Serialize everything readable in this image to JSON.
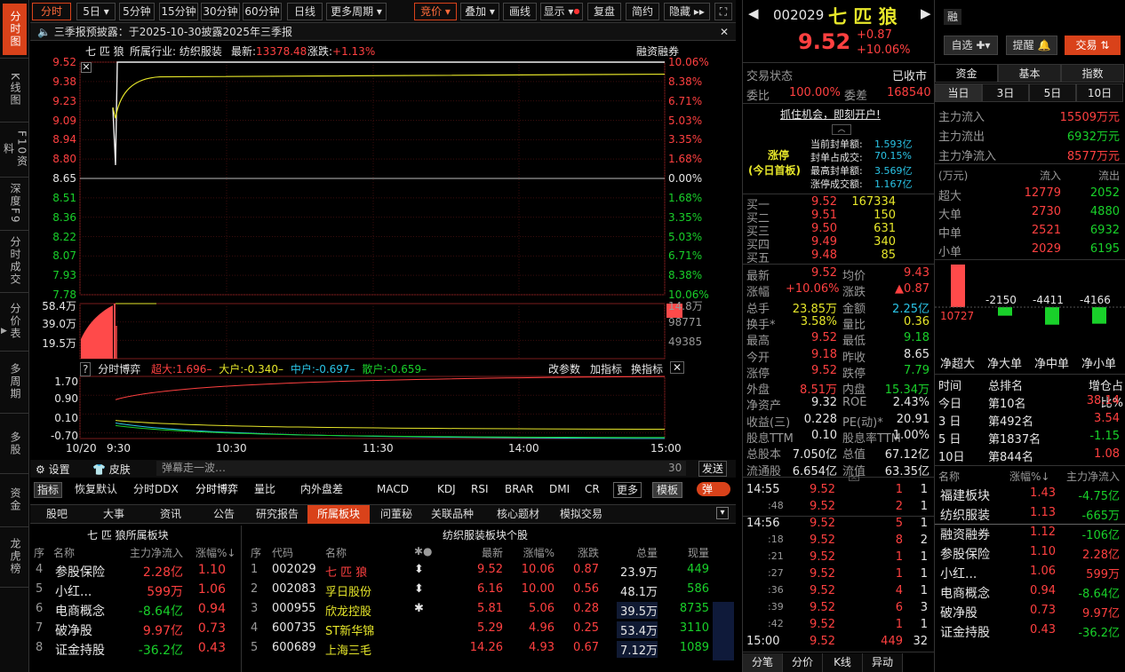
{
  "left_nav": [
    {
      "label": "分时图",
      "active": true
    },
    {
      "label": "K线图"
    },
    {
      "label": "F10资料"
    },
    {
      "label": "深度F9"
    },
    {
      "label": "分时成交"
    },
    {
      "label": "分价表"
    },
    {
      "label": "多周期"
    },
    {
      "label": "多股"
    },
    {
      "label": "资金"
    },
    {
      "label": "龙虎榜"
    }
  ],
  "toolbar": {
    "items": [
      "分时",
      "5日",
      "5分钟",
      "15分钟",
      "30分钟",
      "60分钟",
      "日线",
      "更多周期",
      "竞价",
      "叠加",
      "画线",
      "显示",
      "复盘",
      "简约",
      "隐藏"
    ]
  },
  "notice": {
    "text": "三季报预披露：于2025-10-30披露2025年三季报"
  },
  "chart_header": {
    "name": "七 匹 狼",
    "industry": "所属行业: 纺织服装",
    "latest_label": "最新:",
    "latest": "13378.48",
    "change_label": "涨跌:",
    "change": "+1.13%",
    "margin": "融资融券"
  },
  "chart_data": {
    "type": "line",
    "price_axis": [
      "9.52",
      "9.38",
      "9.23",
      "9.09",
      "8.94",
      "8.80",
      "8.65",
      "8.51",
      "8.36",
      "8.22",
      "8.07",
      "7.93",
      "7.78"
    ],
    "pct_axis": [
      "10.06%",
      "8.38%",
      "6.71%",
      "5.03%",
      "3.35%",
      "1.68%",
      "0.00%",
      "1.68%",
      "3.35%",
      "5.03%",
      "6.71%",
      "8.38%",
      "10.06%"
    ],
    "vol_axis_left": [
      "58.4万",
      "39.0万",
      "19.5万"
    ],
    "vol_axis_right": [
      "14.8万",
      "98771",
      "49385"
    ],
    "x_ticks": [
      "10/20",
      "9:30",
      "10:30",
      "11:30",
      "14:00",
      "15:00"
    ],
    "prev_close": 8.65,
    "open": 9.18,
    "close": 9.52,
    "low": 9.18,
    "flow_axis": [
      "1.70",
      "0.90",
      "0.10",
      "-0.70"
    ]
  },
  "flow_panel": {
    "title": "分时博弈",
    "super": "超大:1.696",
    "big": "大户:-0.340",
    "mid": "中户:-0.697",
    "retail": "散户:-0.659",
    "b1": "改参数",
    "b2": "加指标",
    "b3": "换指标"
  },
  "settings": {
    "settings": "设置",
    "skin": "皮肤",
    "danmu": "弹幕走一波…",
    "count": "30",
    "send": "发送"
  },
  "indicators": [
    "指标",
    "恢复默认",
    "分时DDX",
    "分时博弈",
    "量比",
    "内外盘差",
    "MACD",
    "KDJ",
    "RSI",
    "BRAR",
    "DMI",
    "CR",
    "更多",
    "模板",
    "弹"
  ],
  "info_tabs": [
    "股吧",
    "大事",
    "资讯",
    "公告",
    "研究报告",
    "所属板块",
    "问董秘",
    "关联品种",
    "核心题材",
    "模拟交易"
  ],
  "sector_table": {
    "title": "七 匹 狼所属板块",
    "headers": [
      "序",
      "名称",
      "主力净流入",
      "涨幅%"
    ],
    "rows": [
      [
        "4",
        "参股保险",
        "2.28亿",
        "1.10"
      ],
      [
        "5",
        "小红...",
        "599万",
        "1.06"
      ],
      [
        "6",
        "电商概念",
        "-8.64亿",
        "0.94"
      ],
      [
        "7",
        "破净股",
        "9.97亿",
        "0.73"
      ],
      [
        "8",
        "证金持股",
        "-36.2亿",
        "0.43"
      ]
    ]
  },
  "stock_table": {
    "title": "纺织服装板块个股",
    "headers": [
      "序",
      "代码",
      "名称",
      "",
      "最新",
      "涨幅%",
      "涨跌",
      "总量",
      "现量"
    ],
    "rows": [
      [
        "1",
        "002029",
        "七 匹 狼",
        "⬍",
        "9.52",
        "10.06",
        "0.87",
        "23.9万",
        "449"
      ],
      [
        "2",
        "002083",
        "孚日股份",
        "⬍",
        "6.16",
        "10.00",
        "0.56",
        "48.1万",
        "586"
      ],
      [
        "3",
        "000955",
        "欣龙控股",
        "✱",
        "5.81",
        "5.06",
        "0.28",
        "39.5万",
        "8735"
      ],
      [
        "4",
        "600735",
        "ST新华锦",
        "",
        "5.29",
        "4.96",
        "0.25",
        "53.4万",
        "3110"
      ],
      [
        "5",
        "600689",
        "上海三毛",
        "",
        "14.26",
        "4.93",
        "0.67",
        "7.12万",
        "1089"
      ]
    ]
  },
  "quote": {
    "code": "002029",
    "name": "七 匹 狼",
    "price": "9.52",
    "chg": "+0.87",
    "pct": "+10.06%",
    "tag": "融",
    "btn1": "自选",
    "btn2": "提醒",
    "btn3": "交易",
    "status_label": "交易状态",
    "status": "已收市",
    "wb_label": "委比",
    "wb": "100.00%",
    "wc_label": "委差",
    "wc": "168540",
    "promo": "抓住机会，即刻开户!",
    "limit": {
      "title": "涨停",
      "sub": "(今日首板)",
      "l1": "当前封单额:",
      "v1": "1.593亿",
      "l2": "封单占成交:",
      "v2": "70.15%",
      "l3": "最高封单额:",
      "v3": "3.569亿",
      "l4": "涨停成交额:",
      "v4": "1.167亿"
    },
    "bids": [
      [
        "买一",
        "9.52",
        "167334"
      ],
      [
        "买二",
        "9.51",
        "150"
      ],
      [
        "买三",
        "9.50",
        "631"
      ],
      [
        "买四",
        "9.49",
        "340"
      ],
      [
        "买五",
        "9.48",
        "85"
      ]
    ],
    "stats": [
      [
        "最新",
        "9.52",
        "均价",
        "9.43"
      ],
      [
        "涨幅",
        "+10.06%",
        "涨跌",
        "▲0.87"
      ],
      [
        "总手",
        "23.85万",
        "金额",
        "2.25亿"
      ],
      [
        "换手*",
        "3.58%",
        "量比",
        "0.36"
      ],
      [
        "最高",
        "9.52",
        "最低",
        "9.18"
      ],
      [
        "今开",
        "9.18",
        "昨收",
        "8.65"
      ],
      [
        "涨停",
        "9.52",
        "跌停",
        "7.79"
      ],
      [
        "外盘",
        "8.51万",
        "内盘",
        "15.34万"
      ],
      [
        "净资产",
        "9.32",
        "ROE",
        "2.43%"
      ],
      [
        "收益(三)",
        "0.228",
        "PE(动)*",
        "20.91"
      ],
      [
        "股息TTM",
        "0.10",
        "股息率TTM",
        "1.00%"
      ],
      [
        "总股本",
        "7.050亿",
        "总值",
        "67.12亿"
      ],
      [
        "流通股",
        "6.654亿",
        "流值",
        "63.35亿"
      ]
    ],
    "ticks": [
      [
        "14:55",
        "9.52",
        "1",
        "1"
      ],
      [
        ":48",
        "9.52",
        "2",
        "1"
      ],
      [
        "14:56",
        "9.52",
        "5",
        "1"
      ],
      [
        ":18",
        "9.52",
        "8",
        "2"
      ],
      [
        ":21",
        "9.52",
        "1",
        "1"
      ],
      [
        ":27",
        "9.52",
        "1",
        "1"
      ],
      [
        ":36",
        "9.52",
        "4",
        "1"
      ],
      [
        ":39",
        "9.52",
        "6",
        "3"
      ],
      [
        ":42",
        "9.52",
        "1",
        "1"
      ],
      [
        "15:00",
        "9.52",
        "449",
        "32"
      ]
    ],
    "bottom_tabs": [
      "分笔",
      "分价",
      "K线",
      "异动"
    ]
  },
  "fund": {
    "tabs": [
      "资金",
      "基本",
      "指数"
    ],
    "periods": [
      "当日",
      "3日",
      "5日",
      "10日"
    ],
    "main": [
      [
        "主力流入",
        "15509万元"
      ],
      [
        "主力流出",
        "6932万元"
      ],
      [
        "主力净流入",
        "8577万元"
      ]
    ],
    "flow_head": [
      "(万元)",
      "流入",
      "流出"
    ],
    "flow": [
      [
        "超大",
        "12779",
        "2052"
      ],
      [
        "大单",
        "2730",
        "4880"
      ],
      [
        "中单",
        "2521",
        "6932"
      ],
      [
        "小单",
        "2029",
        "6195"
      ]
    ],
    "bars": [
      {
        "label": "净超大",
        "value": 10727
      },
      {
        "label": "净大单",
        "value": -2150
      },
      {
        "label": "净中单",
        "value": -4411
      },
      {
        "label": "净小单",
        "value": -4166
      }
    ],
    "rank_head": [
      "时间",
      "总排名",
      "增仓占比%"
    ],
    "rank": [
      [
        "今日",
        "第10名",
        "38.14"
      ],
      [
        "3 日",
        "第492名",
        "3.54"
      ],
      [
        "5 日",
        "第1837名",
        "-1.15"
      ],
      [
        "10日",
        "第844名",
        "1.08"
      ]
    ],
    "sec_head": [
      "名称",
      "涨幅%",
      "主力净流入"
    ],
    "sec": [
      [
        "福建板块",
        "1.43",
        "-4.75亿"
      ],
      [
        "纺织服装",
        "1.13",
        "-665万"
      ],
      [
        "融资融券",
        "1.12",
        "-106亿"
      ],
      [
        "参股保险",
        "1.10",
        "2.28亿"
      ],
      [
        "小红...",
        "1.06",
        "599万"
      ],
      [
        "电商概念",
        "0.94",
        "-8.64亿"
      ],
      [
        "破净股",
        "0.73",
        "9.97亿"
      ],
      [
        "证金持股",
        "0.43",
        "-36.2亿"
      ]
    ]
  }
}
